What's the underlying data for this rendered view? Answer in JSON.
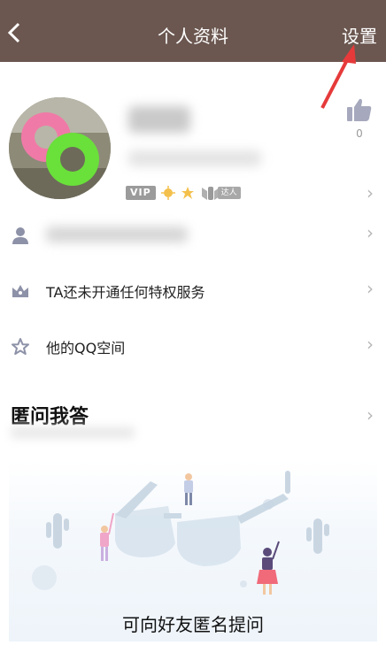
{
  "header": {
    "back_icon": "chevron-left-icon",
    "title": "个人资料",
    "settings_label": "设置"
  },
  "profile": {
    "badges": {
      "vip_text": "VIP",
      "talent_text": "达人"
    },
    "like_count": "0"
  },
  "rows": [
    {
      "icon": "person-icon",
      "label": ""
    },
    {
      "icon": "crown-icon",
      "label": "TA还未开通任何特权服务"
    },
    {
      "icon": "star-outline-icon",
      "label": "他的QQ空间"
    }
  ],
  "anonymous_qa": {
    "title": "匿问我答",
    "invite_text": "可向好友匿名提问"
  },
  "colors": {
    "header_bg": "#6b5750",
    "annotation_red": "#e63a3a"
  }
}
